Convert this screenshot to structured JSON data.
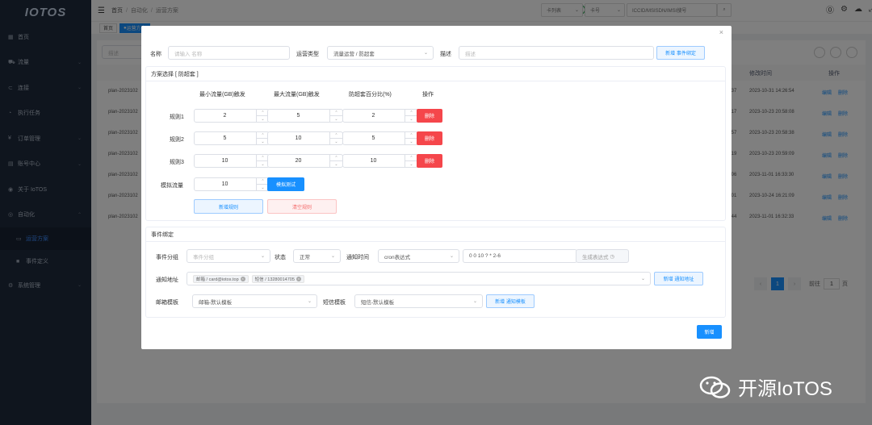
{
  "logo": "IOTOS",
  "sidebar": [
    {
      "label": "首页",
      "icon": "dashboard-icon",
      "arrow": false
    },
    {
      "label": "流量",
      "icon": "cart-icon",
      "arrow": true
    },
    {
      "label": "连接",
      "icon": "link-icon",
      "arrow": true
    },
    {
      "label": "执行任务",
      "icon": "task-icon",
      "arrow": false
    },
    {
      "label": "订单管理",
      "icon": "yen-icon",
      "arrow": true
    },
    {
      "label": "账号中心",
      "icon": "account-icon",
      "arrow": true
    },
    {
      "label": "关于 IoTOS",
      "icon": "globe-icon",
      "arrow": false
    },
    {
      "label": "自动化",
      "icon": "automation-icon",
      "arrow": true
    },
    {
      "label": "运营方案",
      "icon": "plan-icon",
      "arrow": false,
      "sub": true,
      "active": true
    },
    {
      "label": "事件定义",
      "icon": "event-icon",
      "arrow": false,
      "sub": true
    },
    {
      "label": "系统管理",
      "icon": "gear-icon",
      "arrow": true
    }
  ],
  "header": {
    "crumbs": [
      "首页",
      "自动化",
      "运营方案"
    ],
    "card_list": "卡列表",
    "card_no": "卡号",
    "search_ph": "ICCID/MSISDN/IMSI搜号"
  },
  "tags": [
    "首页",
    "运营方案"
  ],
  "bg": {
    "search_ph": "描述",
    "col_time": "修改时间",
    "col_ops": "操作",
    "edit": "编辑",
    "del": "删除",
    "rows": [
      {
        "id": "plan-2023102",
        "v": ":37",
        "t": "2023-10-31 14:26:54"
      },
      {
        "id": "plan-2023102",
        "v": ":17",
        "t": "2023-10-23 20:58:08"
      },
      {
        "id": "plan-2023102",
        "v": ":57",
        "t": "2023-10-23 20:58:38"
      },
      {
        "id": "plan-2023102",
        "v": ":19",
        "t": "2023-10-23 20:59:09"
      },
      {
        "id": "plan-2023102",
        "v": ":06",
        "t": "2023-11-01 16:33:30"
      },
      {
        "id": "plan-2023102",
        "v": ":01",
        "t": "2023-10-24 16:21:09"
      },
      {
        "id": "plan-2023102",
        "v": ":44",
        "t": "2023-11-01 16:32:33"
      }
    ],
    "page": "1",
    "goto": "前往",
    "goto_val": "1",
    "goto_unit": "页"
  },
  "modal": {
    "name_label": "名称",
    "name_ph": "请输入 名称",
    "type_label": "运营类型",
    "type_val": "流量运营 / 防超套",
    "desc_label": "描述",
    "desc_ph": "描述",
    "new_bind": "新增 事件绑定",
    "plan_title": "方案选择 [ 防超套 ]",
    "cols": [
      "最小流量(GB)触发",
      "最大流量(GB)触发",
      "防超套百分比(%)",
      "操作"
    ],
    "rules": [
      {
        "label": "规则1",
        "min": "2",
        "max": "5",
        "pct": "2"
      },
      {
        "label": "规则2",
        "min": "5",
        "max": "10",
        "pct": "5"
      },
      {
        "label": "规则3",
        "min": "10",
        "max": "20",
        "pct": "10"
      }
    ],
    "delete": "删除",
    "sim_label": "模拟流量",
    "sim_val": "10",
    "sim_btn": "模拟测试",
    "add_rule": "新增规则",
    "clear_rule": "清空规则",
    "event_title": "事件绑定",
    "grp_label": "事件分组",
    "grp_ph": "事件分组",
    "status_label": "状态",
    "status_val": "正常",
    "ntime_label": "通知时间",
    "cron_type": "cron表达式",
    "cron_val": "0 0 10 ? * 2-6",
    "gen_btn": "生成表达式",
    "addr_label": "通知地址",
    "addr_chips": [
      "邮箱 / card@iotos.top",
      "短信 / 13280014705"
    ],
    "new_addr": "新增 通知地址",
    "mail_label": "邮箱模板",
    "mail_val": "邮箱-默认模板",
    "sms_label": "短信模板",
    "sms_val": "短信-默认模板",
    "new_tpl": "新增 通知模板",
    "submit": "新增"
  },
  "watermark": "开源IoTOS"
}
